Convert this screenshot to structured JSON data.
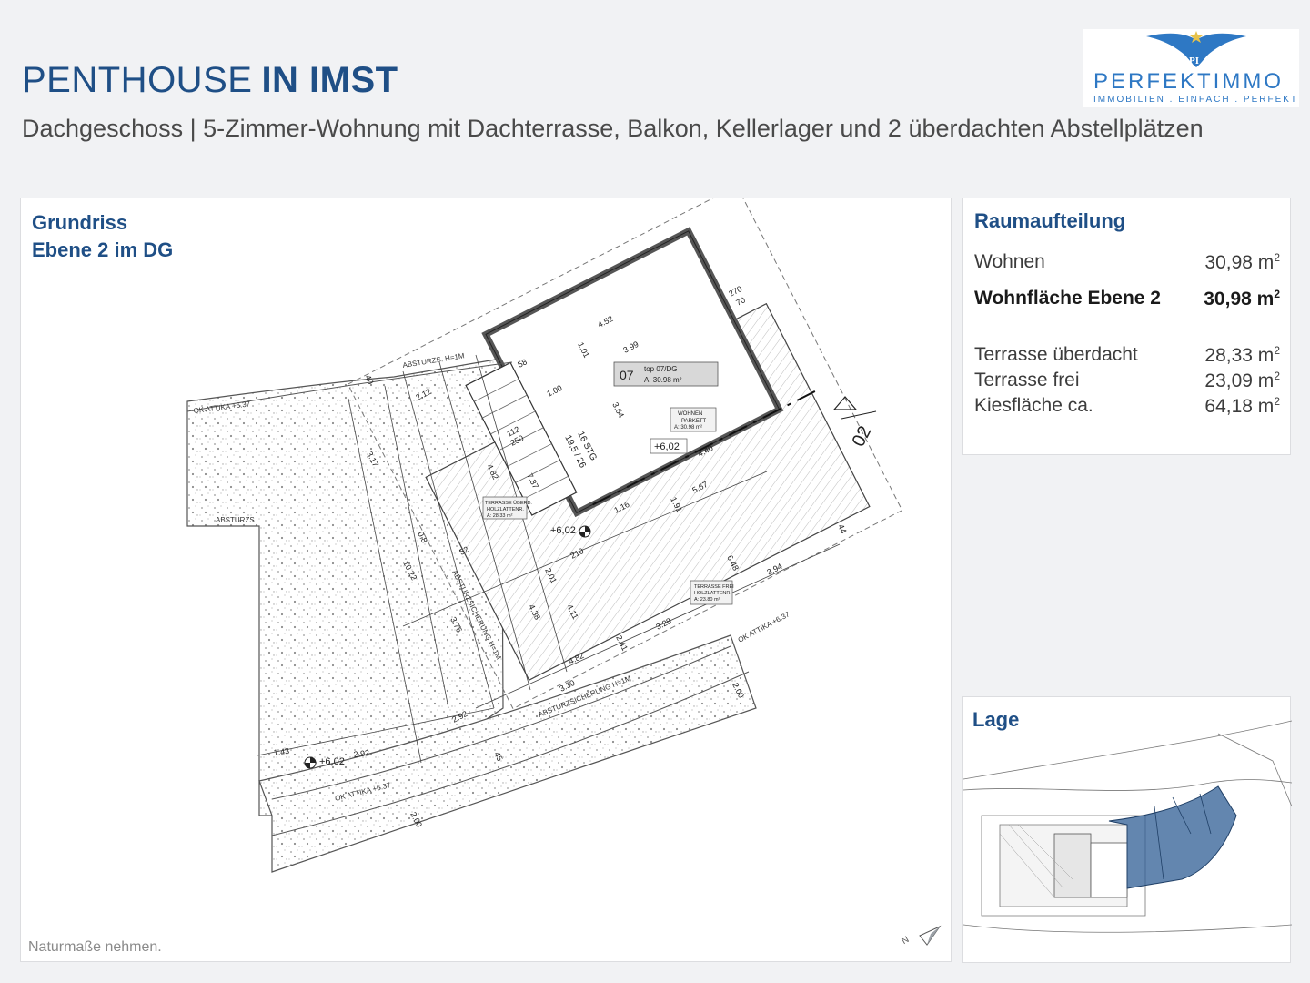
{
  "header": {
    "title_light": "PENTHOUSE",
    "title_bold": "IN IMST",
    "subtitle": "Dachgeschoss | 5-Zimmer-Wohnung mit Dachterrasse, Balkon, Kellerlager und 2 überdachten Abstellplätzen"
  },
  "logo": {
    "wordmark": "PERFEKTIMMO",
    "tagline": "IMMOBILIEN . EINFACH . PERFEKT",
    "brand_color": "#2e78c4"
  },
  "plan": {
    "title_line1": "Grundriss",
    "title_line2": "Ebene 2 im DG",
    "note": "Naturmaße nehmen.",
    "room_no": "07",
    "unit_label": "top 07/DG",
    "unit_area": "A: 30.98 m²",
    "room_name": "WOHNEN",
    "room_floor": "PARKETT",
    "room_area": "A: 30.98 m²",
    "level_1": "+6,02",
    "level_2": "+6,02",
    "level_3": "+6,02",
    "terrace_covered_label": "TERRASSE ÜBERD.",
    "terrace_covered_floor": "HOLZLATTENR.",
    "terrace_covered_area": "A: 28.33 m²",
    "terrace_free_label": "TERRASSE FREI",
    "terrace_free_floor": "HOLZLATTENR.",
    "terrace_free_area": "A: 23.80 m²",
    "section_mark": "02",
    "attika_1": "OK ATTIKA +6.37",
    "attika_2": "OK ATTIKA +6.37",
    "attika_3": "OK ATTIKA +6.37",
    "absturz_1": "ABSTURZS. H=1M",
    "absturz_2": "ABSTURZS.",
    "absturz_3": "ABSTURZSICHERUNG H=1M",
    "absturz_4": "ABSTURZSICHERUNG H=1M",
    "stair_label": "16 STG",
    "stair_dims": "19,5 / 26",
    "dims": [
      "4.52",
      "3.99",
      "1.01",
      "3.64",
      "4.40",
      "5.67",
      "1.91",
      "1.16",
      "4.82",
      "7.37",
      "2.01",
      "4.38",
      "4.11",
      "4.82",
      "2.41",
      "3.30",
      "3.28",
      "6.48",
      "3.94",
      "10.22",
      "3.76",
      "3.17",
      "2.12",
      "2.92",
      "2.92",
      "1.43",
      "2.00",
      "2.00",
      "1.00",
      "112",
      "250",
      "210",
      "270",
      "70",
      "58",
      "52",
      "45",
      "44",
      "40",
      "0.8"
    ]
  },
  "rooms": {
    "title": "Raumaufteilung",
    "items": [
      {
        "label": "Wohnen",
        "value": "30,98 m",
        "sup": "2"
      },
      {
        "label": "Wohnfläche Ebene 2",
        "value": "30,98 m",
        "sup": "2"
      },
      {
        "label": "Terrasse überdacht",
        "value": "28,33 m",
        "sup": "2"
      },
      {
        "label": "Terrasse frei",
        "value": "23,09 m",
        "sup": "2"
      },
      {
        "label": "Kiesfläche ca.",
        "value": "64,18 m",
        "sup": "2"
      }
    ]
  },
  "lage": {
    "title": "Lage",
    "highlight_color": "#2f5e94"
  }
}
